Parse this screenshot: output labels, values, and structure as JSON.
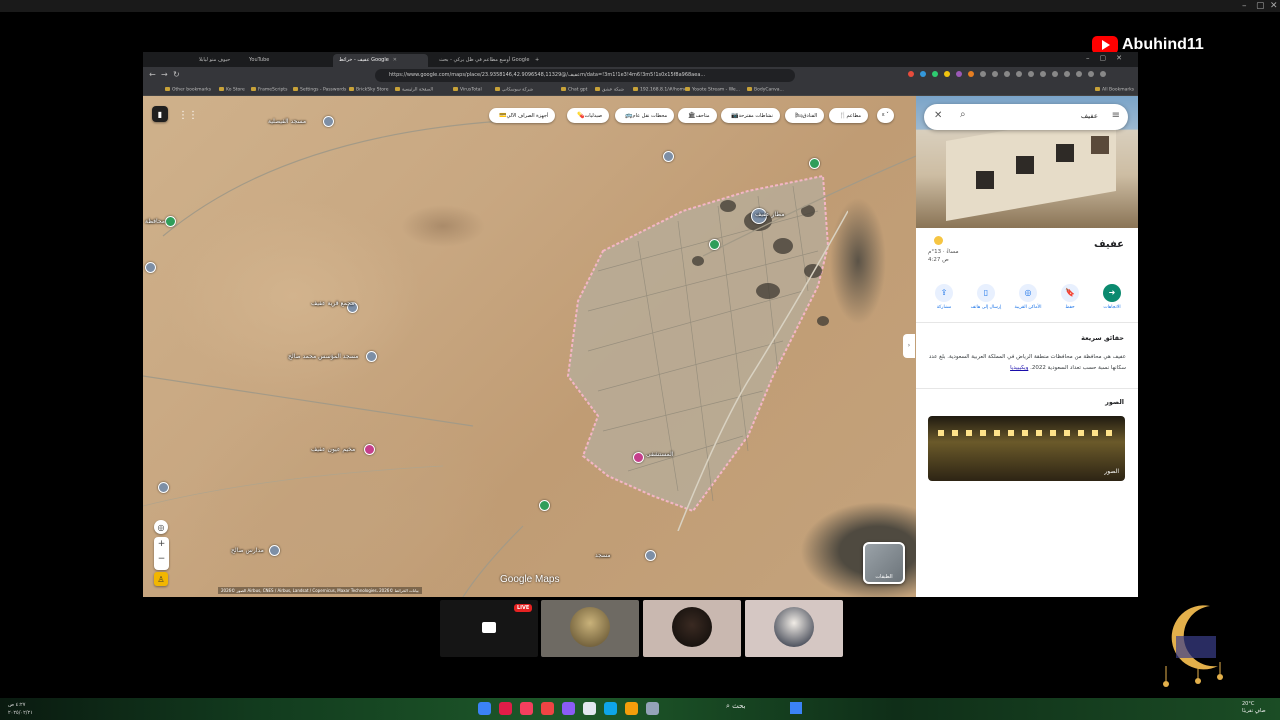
{
  "overlay": {
    "channel_name": "Abuhind11",
    "live_badge": "LIVE"
  },
  "browser": {
    "tabs": [
      {
        "label": "حيوف منو ليابلا"
      },
      {
        "label": "YouTube"
      },
      {
        "label": "عفيف - خرائط Google"
      },
      {
        "label": "أوسع مطاعم في ظل يركي - بحث Google"
      }
    ],
    "url": "https://www.google.com/maps/place/عفيف/@23.9358146,42.9096548,11329m/data=!3m1!1e3!4m6!3m5!1s0x15f8a968aea...",
    "bookmarks": [
      "Other bookmarks",
      "Ko Store",
      "FrameScripts",
      "Settings - Passwords",
      "BrickSky Store",
      "الصفحة الرئيسية",
      "VirusTotal",
      "شركة سوسكاني",
      "Chat gpt",
      "شبكة عشق",
      "192.168.8.1/#/home",
      "Yosote Stream - We...",
      "BodyCanva...",
      "All Bookmarks"
    ]
  },
  "map": {
    "chips": [
      {
        "label": "مطاعم",
        "icon": "🍴"
      },
      {
        "label": "الفنادق",
        "icon": "🛏"
      },
      {
        "label": "نشاطات مقترحة",
        "icon": "📷"
      },
      {
        "label": "متاحف",
        "icon": "🏛"
      },
      {
        "label": "محطات نقل عام",
        "icon": "🚌"
      },
      {
        "label": "صيدليات",
        "icon": "💊"
      },
      {
        "label": "أجهزة الصراف الآلي",
        "icon": "💳"
      }
    ],
    "pois": [
      {
        "label": "مسجد الفيصلية"
      },
      {
        "label": "محافظة"
      },
      {
        "label": "مجمع قرية عفيف"
      },
      {
        "label": "مسجد المؤسس محمد صالح"
      },
      {
        "label": "مخيم عيون عفيف"
      },
      {
        "label": "مدارس صالح"
      },
      {
        "label": "مطار عفيف"
      },
      {
        "label": "المستشفى"
      },
      {
        "label": "مسجد"
      }
    ],
    "logo": "Google Maps",
    "attribution": "الصور ©2026 Airbus, CNES / Airbus, Landsat / Copernicus, Maxar Technologies، بيانات الخرائط ©2026",
    "layers_label": "الطبقات"
  },
  "panel": {
    "search_value": "عفيف",
    "title": "عفيف",
    "weather_line1": "مساءً · 13°م",
    "weather_line2": "4:27 ص",
    "actions": [
      {
        "label": "الاتجاهات",
        "icon": "➜"
      },
      {
        "label": "حفظ",
        "icon": "🔖"
      },
      {
        "label": "الأماكن القريبة",
        "icon": "◎"
      },
      {
        "label": "إرسال إلى هاتف",
        "icon": "▯"
      },
      {
        "label": "مشاركة",
        "icon": "⇪"
      }
    ],
    "facts_title": "حقائق سريعة",
    "facts_text": "عفيف هي محافظة من محافظات منطقة الرياض في المملكة العربية السعودية. بلغ عدد سكانها نسبة حسب تعداد السعودية 2022.",
    "facts_link": "ويكيبيديا",
    "photos_title": "الصور",
    "photos_label": "الصور"
  },
  "taskbar": {
    "time": "٤:٢٧ ص",
    "date": "٢٠٢٥/٠٢/٢١",
    "weather": "20°C",
    "weather_desc": "صافٍ تقريبًا",
    "search_label": "بحث"
  }
}
